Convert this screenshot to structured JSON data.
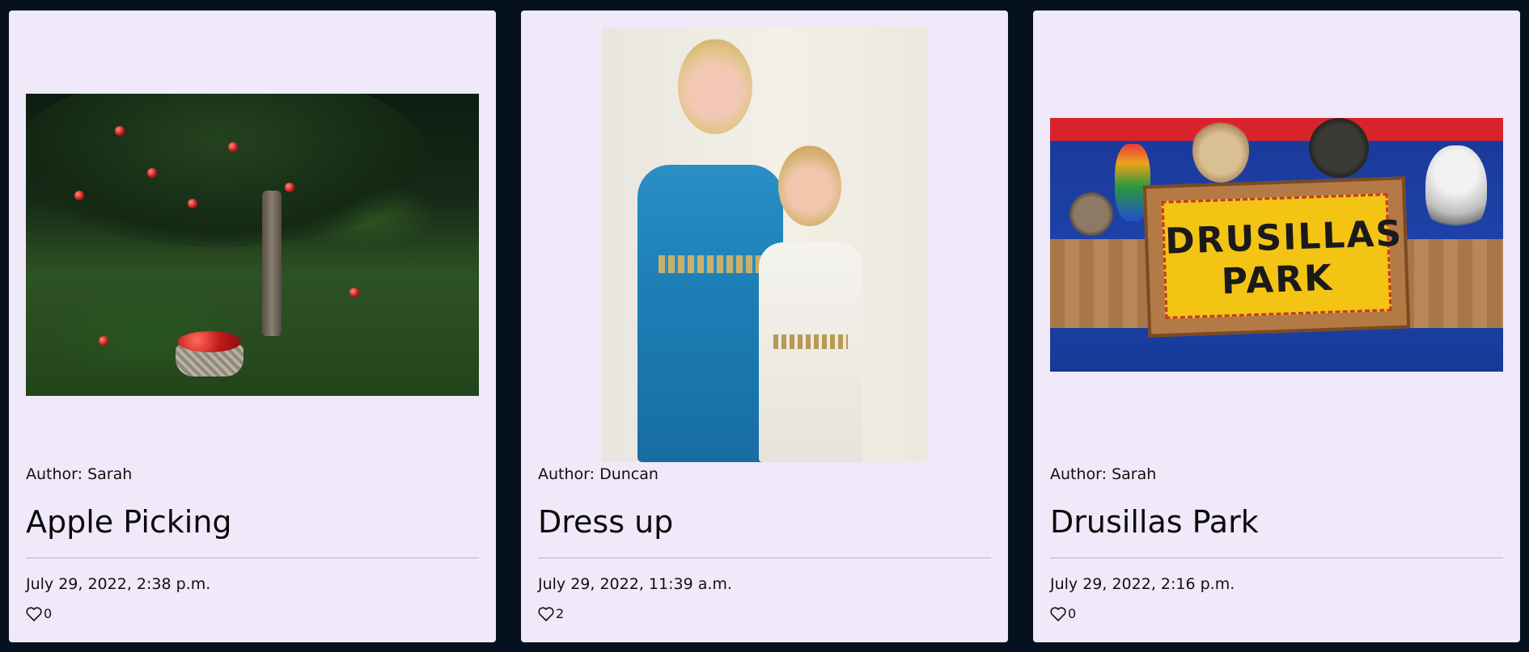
{
  "posts": [
    {
      "author": "Author: Sarah",
      "title": "Apple Picking",
      "date": "July 29, 2022, 2:38 p.m.",
      "likes": "0",
      "image_subject": "apple orchard with basket"
    },
    {
      "author": "Author: Duncan",
      "title": "Dress up",
      "date": "July 29, 2022, 11:39 a.m.",
      "likes": "2",
      "image_subject": "two girls in greek dresses"
    },
    {
      "author": "Author: Sarah",
      "title": "Drusillas Park",
      "date": "July 29, 2022, 2:16 p.m.",
      "likes": "0",
      "image_subject": "Drusillas Park sign with animals",
      "image_sign_text": "DRUSILLAS PARK"
    }
  ],
  "icons": {
    "like": "heart-outline-icon"
  },
  "colors": {
    "page_background": "#06111f",
    "card_background": "#efe9f9",
    "text": "#111111",
    "divider": "#b8b4c2"
  }
}
